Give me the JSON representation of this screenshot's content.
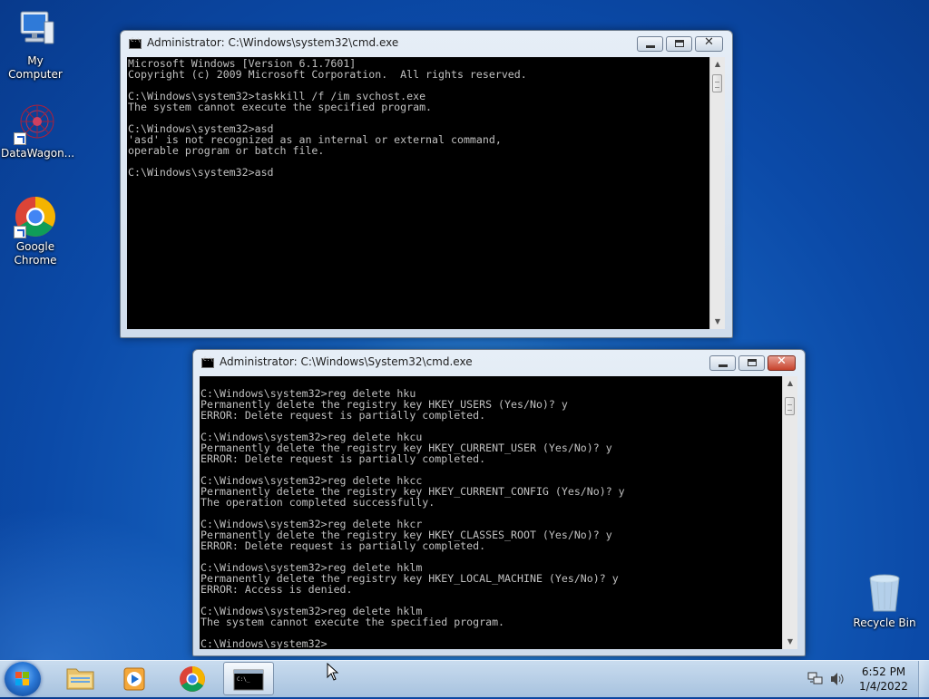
{
  "desktop": {
    "icons": [
      {
        "label": "My Computer"
      },
      {
        "label": "DataWagon..."
      },
      {
        "label_line1": "Google",
        "label_line2": "Chrome"
      },
      {
        "label": "Recycle Bin"
      }
    ]
  },
  "window1": {
    "title": "Administrator: C:\\Windows\\system32\\cmd.exe",
    "lines": [
      "Microsoft Windows [Version 6.1.7601]",
      "Copyright (c) 2009 Microsoft Corporation.  All rights reserved.",
      "",
      "C:\\Windows\\system32>taskkill /f /im svchost.exe",
      "The system cannot execute the specified program.",
      "",
      "C:\\Windows\\system32>asd",
      "'asd' is not recognized as an internal or external command,",
      "operable program or batch file.",
      "",
      "C:\\Windows\\system32>asd"
    ]
  },
  "window2": {
    "title": "Administrator: C:\\Windows\\System32\\cmd.exe",
    "lines": [
      "",
      "C:\\Windows\\system32>reg delete hku",
      "Permanently delete the registry key HKEY_USERS (Yes/No)? y",
      "ERROR: Delete request is partially completed.",
      "",
      "C:\\Windows\\system32>reg delete hkcu",
      "Permanently delete the registry key HKEY_CURRENT_USER (Yes/No)? y",
      "ERROR: Delete request is partially completed.",
      "",
      "C:\\Windows\\system32>reg delete hkcc",
      "Permanently delete the registry key HKEY_CURRENT_CONFIG (Yes/No)? y",
      "The operation completed successfully.",
      "",
      "C:\\Windows\\system32>reg delete hkcr",
      "Permanently delete the registry key HKEY_CLASSES_ROOT (Yes/No)? y",
      "ERROR: Delete request is partially completed.",
      "",
      "C:\\Windows\\system32>reg delete hklm",
      "Permanently delete the registry key HKEY_LOCAL_MACHINE (Yes/No)? y",
      "ERROR: Access is denied.",
      "",
      "C:\\Windows\\system32>reg delete hklm",
      "The system cannot execute the specified program.",
      "",
      "C:\\Windows\\system32>"
    ]
  },
  "taskbar": {
    "time": "6:52 PM",
    "date": "1/4/2022",
    "pinned": [
      "start-button",
      "windows-explorer-icon",
      "media-player-icon",
      "chrome-icon",
      "cmd-icon"
    ]
  },
  "colors": {
    "console_bg": "#000000",
    "console_fg": "#c0c0c0",
    "close_active": "#c7432c"
  }
}
